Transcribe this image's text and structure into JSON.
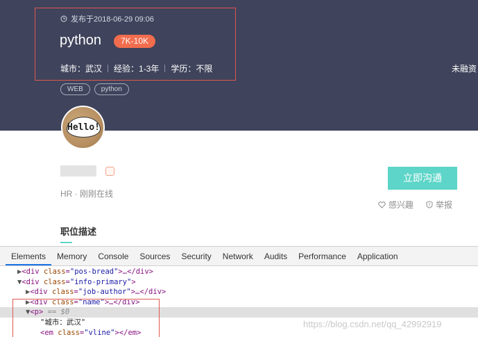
{
  "job": {
    "published": "发布于2018-06-29 09:06",
    "title": "python",
    "salary": "7K-10K",
    "city": "城市：武汉",
    "experience": "经验：1-3年",
    "education": "学历：不限",
    "funding": "未融资",
    "tags": [
      "WEB",
      "python"
    ]
  },
  "avatar": {
    "text": "Hello!"
  },
  "recruiter": {
    "role": "HR · 刚刚在线",
    "chat_label": "立即沟通",
    "interest_label": "感兴趣",
    "report_label": "举报"
  },
  "section": {
    "title": "职位描述"
  },
  "devtools": {
    "tabs": [
      "Elements",
      "Memory",
      "Console",
      "Sources",
      "Security",
      "Network",
      "Audits",
      "Performance",
      "Application"
    ],
    "active_tab": "Elements",
    "dom": {
      "row1": {
        "tri": "▶",
        "open": "<div ",
        "attr": "class",
        "eq": "=",
        "val": "\"pos-bread\"",
        "rest": ">…</div>"
      },
      "row2": {
        "tri": "▼",
        "open": "<div ",
        "attr": "class",
        "eq": "=",
        "val": "\"info-primary\"",
        "rest": ">"
      },
      "row3": {
        "tri": "▶",
        "open": "<div ",
        "attr": "class",
        "eq": "=",
        "val": "\"job-author\"",
        "rest": ">…</div>"
      },
      "row4": {
        "tri": "▶",
        "open": "<div ",
        "attr": "class",
        "eq": "=",
        "val": "\"name\"",
        "rest": ">…</div>"
      },
      "row5": {
        "tri": "▼",
        "open": "<p>",
        "hint": " == $0"
      },
      "row6": {
        "text": "\"城市：武汉\""
      },
      "row7": {
        "open": "<em ",
        "attr": "class",
        "eq": "=",
        "val": "\"vline\"",
        "rest": "></em>"
      }
    }
  },
  "watermark": "https://blog.csdn.net/qq_42992919",
  "colors": {
    "banner": "#3f435b",
    "salary": "#f26d4e",
    "accent": "#5dd5c8",
    "highlight": "#e0584f"
  }
}
